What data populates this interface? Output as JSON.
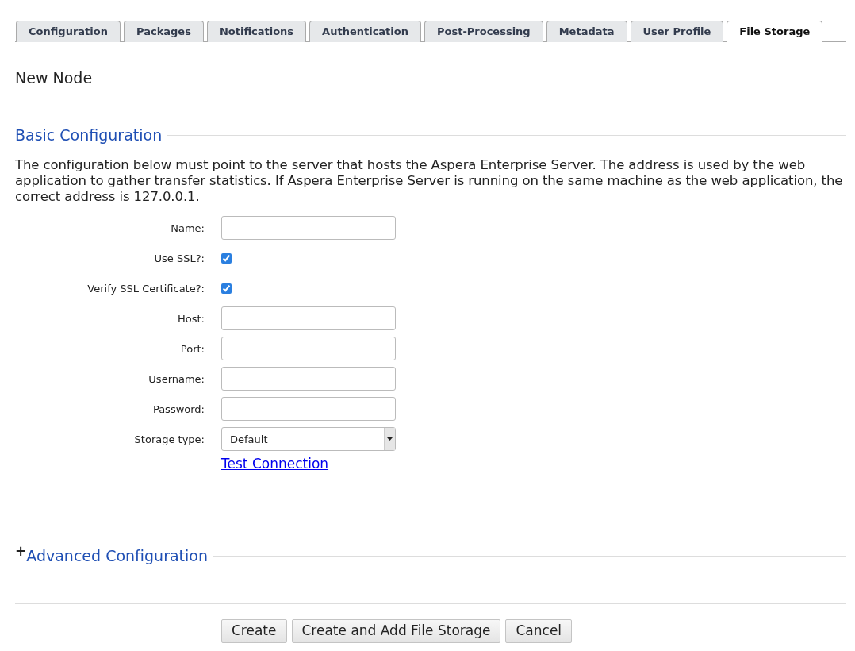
{
  "tabs": [
    {
      "label": "Configuration",
      "selected": false
    },
    {
      "label": "Packages",
      "selected": false
    },
    {
      "label": "Notifications",
      "selected": false
    },
    {
      "label": "Authentication",
      "selected": false
    },
    {
      "label": "Post-Processing",
      "selected": false
    },
    {
      "label": "Metadata",
      "selected": false
    },
    {
      "label": "User Profile",
      "selected": false
    },
    {
      "label": "File Storage",
      "selected": true
    }
  ],
  "page_title": "New Node",
  "basic_section": {
    "title": "Basic Configuration",
    "description": "The configuration below must point to the server that hosts the Aspera Enterprise Server. The address is used by the web application to gather transfer statistics. If Aspera Enterprise Server is running on the same machine as the web application, the correct address is 127.0.0.1.",
    "fields": [
      {
        "kind": "text",
        "label": "Name:"
      },
      {
        "kind": "checkbox",
        "label": "Use SSL?:",
        "checked": true
      },
      {
        "kind": "checkbox",
        "label": "Verify SSL Certificate?:",
        "checked": true
      },
      {
        "kind": "text",
        "label": "Host:"
      },
      {
        "kind": "text",
        "label": "Port:"
      },
      {
        "kind": "text",
        "label": "Username:"
      },
      {
        "kind": "password",
        "label": "Password:"
      },
      {
        "kind": "select",
        "label": "Storage type:",
        "value": "Default"
      }
    ],
    "link": "Test Connection"
  },
  "advanced_section": {
    "expander": "+",
    "title": "Advanced Configuration"
  },
  "buttons": [
    "Create",
    "Create and Add File Storage",
    "Cancel"
  ]
}
